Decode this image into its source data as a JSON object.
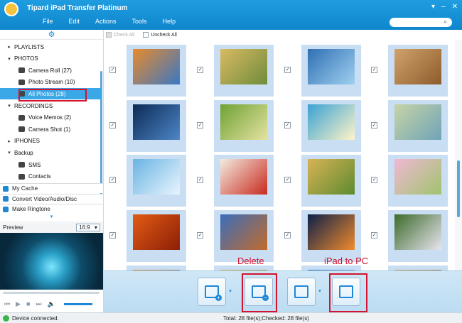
{
  "app": {
    "title": "Tipard iPad Transfer Platinum",
    "window_buttons": [
      "▾",
      "–",
      "✕"
    ]
  },
  "menu": [
    "File",
    "Edit",
    "Actions",
    "Tools",
    "Help"
  ],
  "search": {
    "placeholder": ""
  },
  "sidebar": {
    "items": [
      {
        "label": "PLAYLISTS",
        "arrow": "▸",
        "level": 0
      },
      {
        "label": "PHOTOS",
        "arrow": "▾",
        "level": 0
      },
      {
        "label": "Camera Roll (27)",
        "level": 1
      },
      {
        "label": "Photo Stream (10)",
        "level": 1
      },
      {
        "label": "All Photos (28)",
        "level": 1,
        "selected": true
      },
      {
        "label": "RECORDINGS",
        "arrow": "▾",
        "level": 0
      },
      {
        "label": "Voice Memos (2)",
        "level": 1
      },
      {
        "label": "Camera Shot (1)",
        "level": 1
      },
      {
        "label": "IPHONES",
        "arrow": "▸",
        "level": 0
      },
      {
        "label": "Backup",
        "arrow": "▾",
        "level": 0
      },
      {
        "label": "SMS",
        "level": 1
      },
      {
        "label": "Contacts",
        "level": 1
      }
    ],
    "tools": [
      "My Cache",
      "Convert Video/Audio/Disc",
      "Make Ringtone"
    ]
  },
  "preview": {
    "label": "Preview",
    "ratio": "16:9"
  },
  "checkbar": {
    "check_all": "Check All",
    "uncheck_all": "Uncheck All"
  },
  "photos": [
    {
      "c1": "#e88a2d",
      "c2": "#3a78c4"
    },
    {
      "c1": "#d9ba63",
      "c2": "#6f8c3b"
    },
    {
      "c1": "#2f6fb3",
      "c2": "#9fd0f0"
    },
    {
      "c1": "#d1a26b",
      "c2": "#8c5c2c"
    },
    {
      "c1": "#0c2a55",
      "c2": "#4d86c7"
    },
    {
      "c1": "#6fa135",
      "c2": "#e4e3a0"
    },
    {
      "c1": "#3aa2d4",
      "c2": "#fff4c8"
    },
    {
      "c1": "#c7d4a6",
      "c2": "#6fa4b8"
    },
    {
      "c1": "#6ab3e3",
      "c2": "#e8f5fd"
    },
    {
      "c1": "#f3ebe0",
      "c2": "#c92a1e"
    },
    {
      "c1": "#d8b355",
      "c2": "#5d8b2f"
    },
    {
      "c1": "#f0b8d4",
      "c2": "#9fc46d"
    },
    {
      "c1": "#e25b14",
      "c2": "#8c1f07"
    },
    {
      "c1": "#3a6fbb",
      "c2": "#c26a2c"
    },
    {
      "c1": "#0d1f4a",
      "c2": "#f08b2b"
    },
    {
      "c1": "#3c6b2a",
      "c2": "#e8e4f0"
    }
  ],
  "toolbar": [
    "add-to-device",
    "delete",
    "transfer-to-device",
    "ipad-to-pc"
  ],
  "annotations": {
    "delete_label": "Delete",
    "ipad_to_pc_label": "iPad to PC"
  },
  "status": {
    "text": "Device connected.",
    "count": "Total: 28 file(s);Checked: 28 file(s)"
  }
}
